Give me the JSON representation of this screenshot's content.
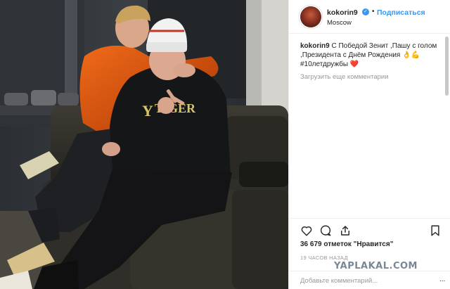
{
  "post": {
    "username": "kokorin9",
    "follow_label": "Подписаться",
    "location": "Moscow",
    "caption": {
      "username": "kokorin9",
      "text": "С Победой Зенит ,Пашу с голом ,Президента с Днём Рождения 👌💪#10летдружбы ❤️"
    },
    "load_more_comments": "Загрузить еще комментарии",
    "likes": "36 679 отметок \"Нравится\"",
    "timestamp": "19 ЧАСОВ НАЗАД",
    "comment_placeholder": "Добавьте комментарий...",
    "comment_more": "..."
  },
  "watermark": "YAPLAKAL.COM",
  "icons": {
    "verified": "verified-badge-icon",
    "like": "heart-icon",
    "comment": "comment-bubble-icon",
    "share": "share-icon",
    "save": "bookmark-icon"
  },
  "colors": {
    "link_blue": "#3897f0",
    "muted_gray": "#999999",
    "text": "#262626",
    "divider": "#efefef"
  }
}
